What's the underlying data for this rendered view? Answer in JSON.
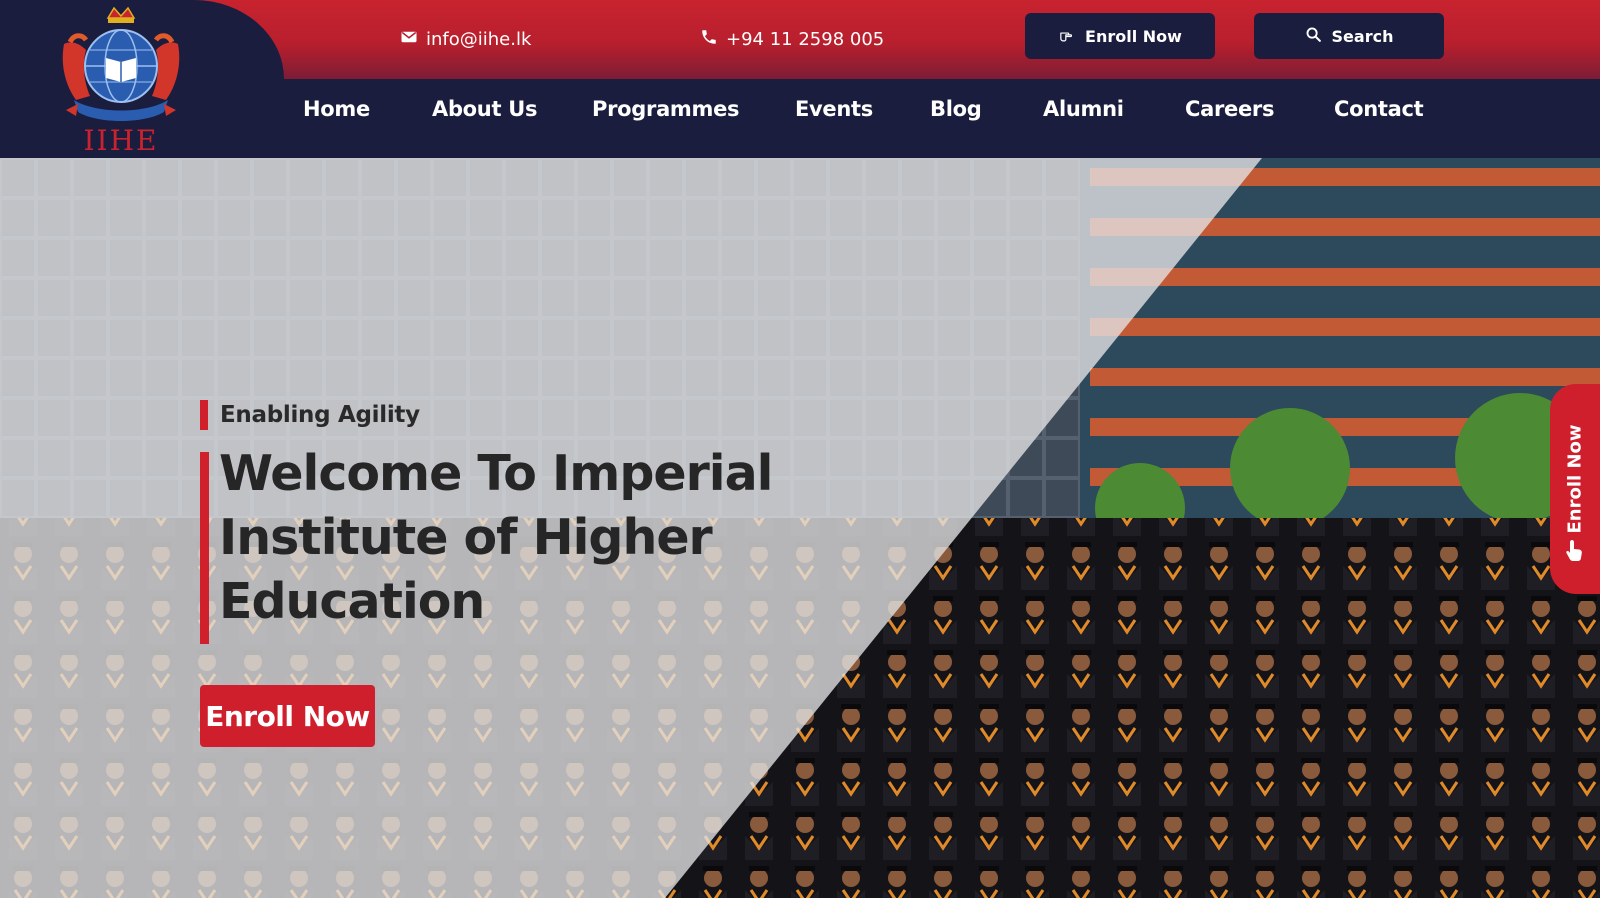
{
  "brand": {
    "logo_text": "IIHE"
  },
  "contact": {
    "email": "info@iihe.lk",
    "phone": "+94 11 2598 005"
  },
  "top_buttons": {
    "enroll_label": "Enroll Now",
    "search_label": "Search"
  },
  "nav": {
    "items": [
      {
        "label": "Home"
      },
      {
        "label": "About Us"
      },
      {
        "label": "Programmes"
      },
      {
        "label": "Events"
      },
      {
        "label": "Blog"
      },
      {
        "label": "Alumni"
      },
      {
        "label": "Careers"
      },
      {
        "label": "Contact"
      }
    ]
  },
  "hero": {
    "tagline": "Enabling Agility",
    "title_line1": "Welcome To Imperial",
    "title_line2": "Institute of Higher",
    "title_line3": "Education",
    "cta_label": "Enroll Now"
  },
  "side_tab": {
    "label": "Enroll Now"
  },
  "colors": {
    "navy": "#1b1d3e",
    "brand_red": "#cf1f2c",
    "topbar_red": "#c8232f",
    "text_dark": "#262626"
  },
  "icons": {
    "email": "envelope-icon",
    "phone": "phone-icon",
    "enroll": "pointing-hand-icon",
    "search": "search-icon"
  }
}
